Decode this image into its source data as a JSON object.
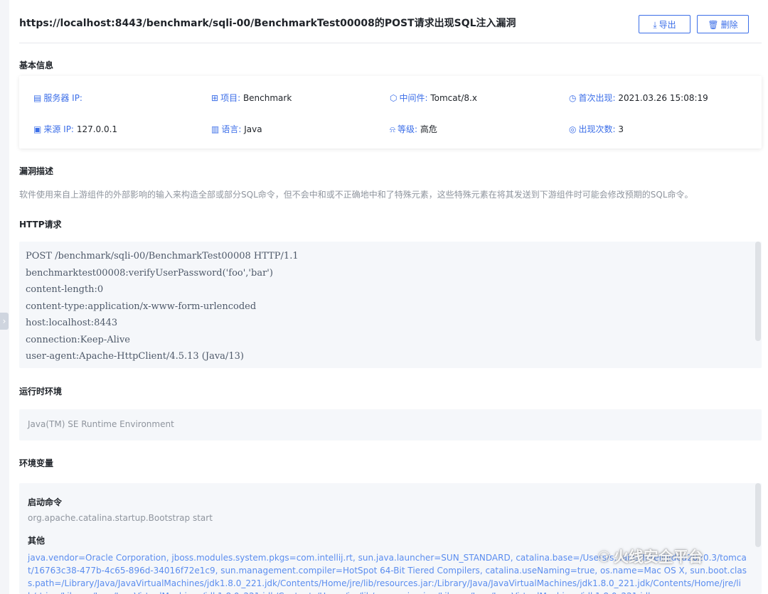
{
  "header": {
    "title": "https://localhost:8443/benchmark/sqli-00/BenchmarkTest00008的POST请求出现SQL注入漏洞",
    "export_label": "导出",
    "delete_label": "删除",
    "export_icon": "download-icon",
    "delete_icon": "trash-icon"
  },
  "basic_info": {
    "title": "基本信息",
    "server_ip": {
      "label": "服务器 IP:",
      "value": ""
    },
    "project": {
      "label": "项目:",
      "value": "Benchmark"
    },
    "middleware": {
      "label": "中间件:",
      "value": "Tomcat/8.x"
    },
    "first_seen": {
      "label": "首次出现:",
      "value": "2021.03.26 15:08:19"
    },
    "source_ip": {
      "label": "来源 IP:",
      "value": "127.0.0.1"
    },
    "language": {
      "label": "语言:",
      "value": "Java"
    },
    "level": {
      "label": "等级:",
      "value": "高危"
    },
    "occurrences": {
      "label": "出现次数:",
      "value": "3"
    }
  },
  "vuln_desc": {
    "title": "漏洞描述",
    "text": "软件使用来自上游组件的外部影响的输入来构造全部或部分SQL命令，但不会中和或不正确地中和了特殊元素，这些特殊元素在将其发送到下游组件时可能会修改预期的SQL命令。"
  },
  "http_request": {
    "title": "HTTP请求",
    "lines": [
      "POST /benchmark/sqli-00/BenchmarkTest00008 HTTP/1.1",
      "benchmarktest00008:verifyUserPassword('foo','bar')",
      "content-length:0",
      "content-type:application/x-www-form-urlencoded",
      "host:localhost:8443",
      "connection:Keep-Alive",
      "user-agent:Apache-HttpClient/4.5.13 (Java/13)"
    ]
  },
  "runtime": {
    "title": "运行时环境",
    "value": "Java(TM) SE Runtime Environment"
  },
  "env_vars": {
    "title": "环境变量",
    "startup_label": "启动命令",
    "startup_value": "org.apache.catalina.startup.Bootstrap start",
    "other_label": "其他",
    "other_value": "java.vendor=Oracle Corporation, jboss.modules.system.pkgs=com.intellij.rt, sun.java.launcher=SUN_STANDARD, catalina.base=/Users/s...ains/IntelliJIdea2020.3/tomcat/16763c38-477b-4c65-896d-34016f72e1c9, sun.management.compiler=HotSpot 64-Bit Tiered Compilers, catalina.useNaming=true, os.name=Mac OS X, sun.boot.class.path=/Library/Java/JavaVirtualMachines/jdk1.8.0_221.jdk/Contents/Home/jre/lib/resources.jar:/Library/Java/JavaVirtualMachines/jdk1.8.0_221.jdk/Contents/Home/jre/lib/rt.jar:/Library/Java/JavaVirtualMachines/jdk1.8.0_221.jdk/Contents/Home/jre/lib/sunrsasign.jar:/Library/Java/JavaVirtualMachines/jdk1.8.0_221.jdk"
  },
  "watermark": {
    "text": "火线安全平台"
  },
  "colors": {
    "accent": "#3b6ee8",
    "link_text": "#5b8def",
    "muted": "#8f959e",
    "code_bg": "#f5f7fa"
  }
}
